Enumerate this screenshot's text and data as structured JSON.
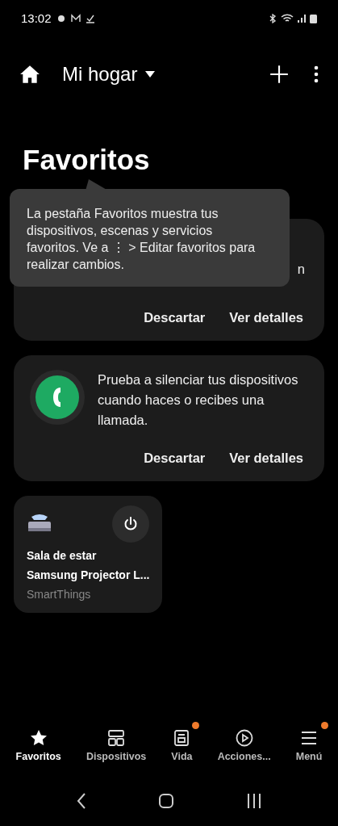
{
  "status_bar": {
    "time": "13:02"
  },
  "header": {
    "home_name": "Mi hogar"
  },
  "title": "Favoritos",
  "tooltip": {
    "text": "La pestaña Favoritos muestra tus dispositivos, escenas y servicios favoritos. Ve a ⋮ > Editar favoritos para realizar cambios."
  },
  "cards": [
    {
      "kind": "hidden",
      "text": "n",
      "actions": [
        "Descartar",
        "Ver detalles"
      ]
    },
    {
      "kind": "call",
      "text": "Prueba a silenciar tus dispositivos cuando haces o recibes una llamada.",
      "actions": [
        "Descartar",
        "Ver detalles"
      ]
    }
  ],
  "devices": [
    {
      "room": "Sala de estar",
      "name": "Samsung Projector L...",
      "source": "SmartThings"
    }
  ],
  "nav": [
    {
      "label": "Favoritos",
      "kind": "star",
      "selected": true,
      "badge": false
    },
    {
      "label": "Dispositivos",
      "kind": "grid",
      "selected": false,
      "badge": false
    },
    {
      "label": "Vida",
      "kind": "life",
      "selected": false,
      "badge": true
    },
    {
      "label": "Acciones...",
      "kind": "play",
      "selected": false,
      "badge": false
    },
    {
      "label": "Menú",
      "kind": "menu",
      "selected": false,
      "badge": true
    }
  ]
}
